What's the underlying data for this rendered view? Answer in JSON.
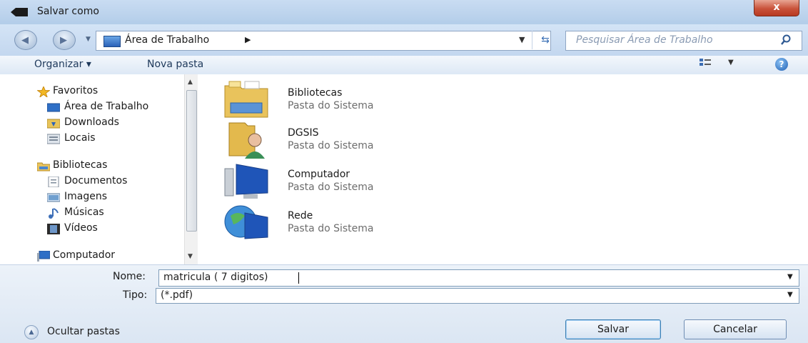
{
  "window": {
    "title": "Salvar como",
    "close_label": "x"
  },
  "address": {
    "location": "Área de Trabalho",
    "search_placeholder": "Pesquisar Área de Trabalho"
  },
  "toolbar": {
    "organize": "Organizar",
    "new_folder": "Nova pasta"
  },
  "sidebar": {
    "items": [
      {
        "label": "Favoritos",
        "icon": "star-icon"
      },
      {
        "label": "Área de Trabalho",
        "icon": "desktop-icon"
      },
      {
        "label": "Downloads",
        "icon": "downloads-icon"
      },
      {
        "label": "Locais",
        "icon": "recent-places-icon"
      },
      {
        "label": "Bibliotecas",
        "icon": "libraries-icon"
      },
      {
        "label": "Documentos",
        "icon": "documents-icon"
      },
      {
        "label": "Imagens",
        "icon": "pictures-icon"
      },
      {
        "label": "Músicas",
        "icon": "music-icon"
      },
      {
        "label": "Vídeos",
        "icon": "videos-icon"
      },
      {
        "label": "Computador",
        "icon": "computer-icon"
      }
    ]
  },
  "content": {
    "items": [
      {
        "name": "Bibliotecas",
        "type": "Pasta do Sistema",
        "icon": "libraries-folder-icon"
      },
      {
        "name": "DGSIS",
        "type": "Pasta do Sistema",
        "icon": "user-folder-icon"
      },
      {
        "name": "Computador",
        "type": "Pasta do Sistema",
        "icon": "computer-icon"
      },
      {
        "name": "Rede",
        "type": "Pasta do Sistema",
        "icon": "network-icon"
      }
    ]
  },
  "form": {
    "name_label": "Nome:",
    "name_value": "matricula ( 7 digitos)",
    "type_label": "Tipo:",
    "type_value": "(*.pdf)",
    "hide_folders": "Ocultar pastas",
    "save": "Salvar",
    "cancel": "Cancelar"
  }
}
